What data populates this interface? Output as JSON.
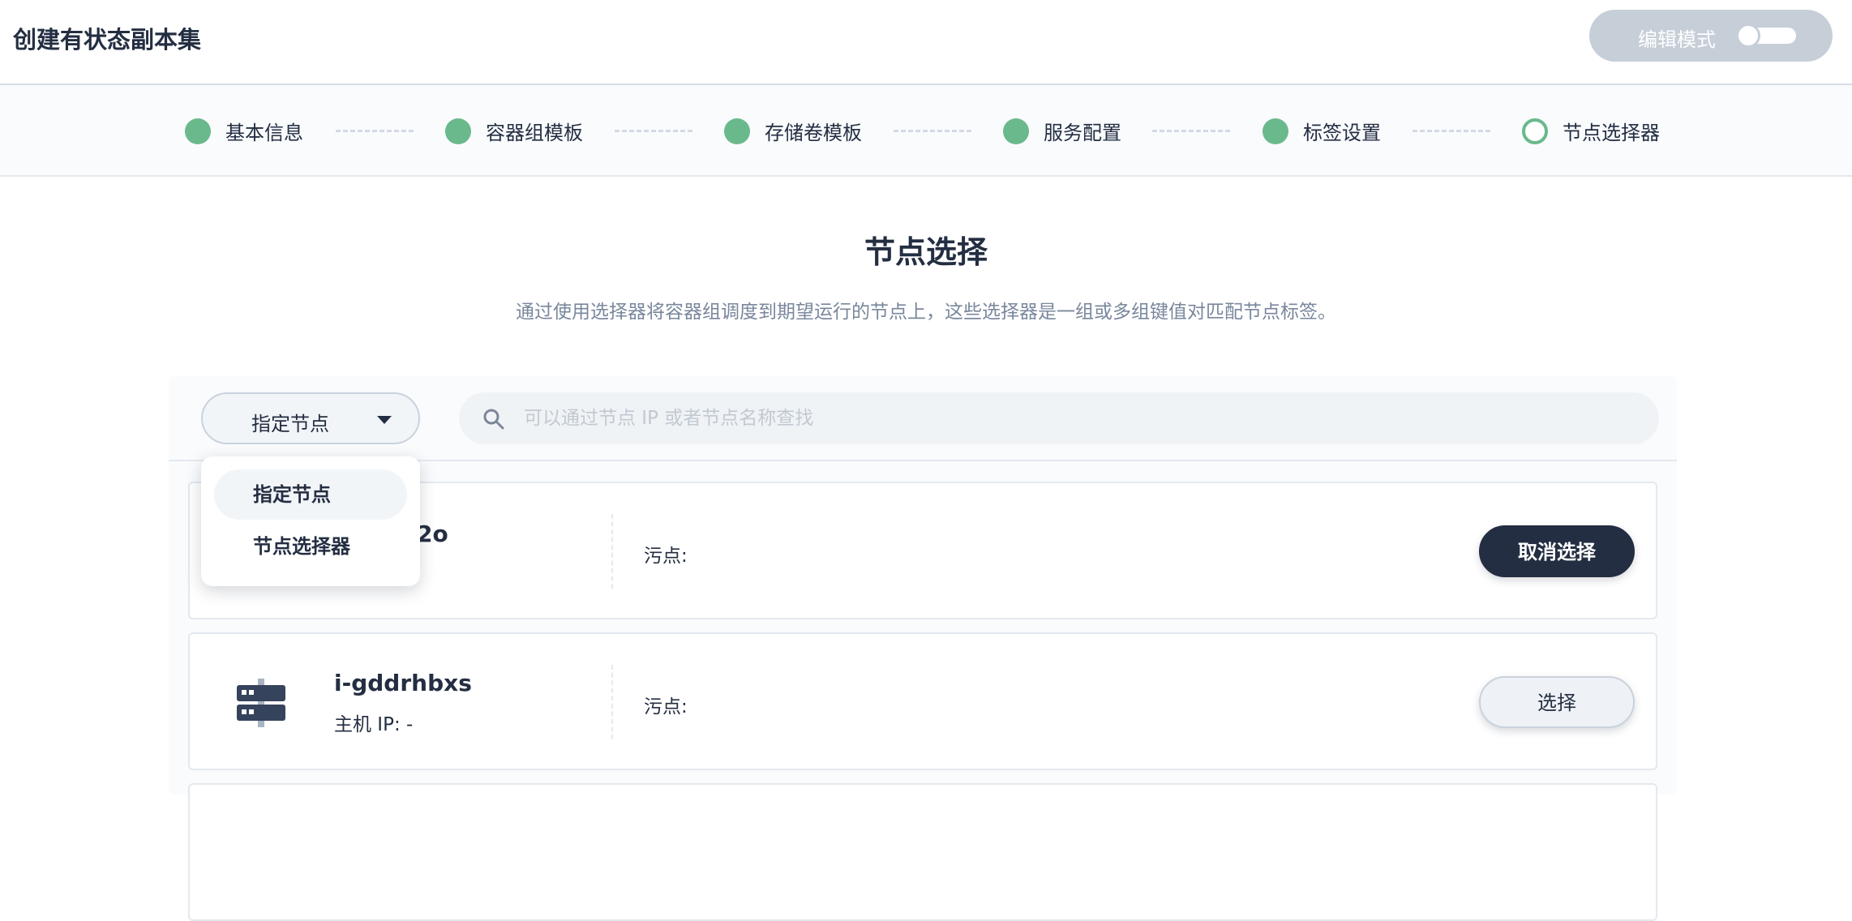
{
  "header": {
    "title": "创建有状态副本集",
    "edit_mode_label": "编辑模式"
  },
  "steps": [
    {
      "label": "基本信息",
      "status": "done"
    },
    {
      "label": "容器组模板",
      "status": "done"
    },
    {
      "label": "存储卷模板",
      "status": "done"
    },
    {
      "label": "服务配置",
      "status": "done"
    },
    {
      "label": "标签设置",
      "status": "done"
    },
    {
      "label": "节点选择器",
      "status": "current"
    }
  ],
  "section": {
    "title": "节点选择",
    "description": "通过使用选择器将容器组调度到期望运行的节点上，这些选择器是一组或多组键值对匹配节点标签。"
  },
  "toolbar": {
    "select_value": "指定节点",
    "search_placeholder": "可以通过节点 IP 或者节点名称查找"
  },
  "dropdown": {
    "options": [
      "指定节点",
      "节点选择器"
    ],
    "selected": "指定节点"
  },
  "nodes": [
    {
      "name_visible_fragment": "2o",
      "taint_label": "污点:",
      "button_label": "取消选择",
      "selected": true
    },
    {
      "name": "i-gddrhbxs",
      "ip": "主机 IP: -",
      "taint_label": "污点:",
      "button_label": "选择",
      "selected": false
    }
  ],
  "colors": {
    "step_done": "#6ab98c",
    "primary_dark": "#242e42",
    "muted_text": "#79879c"
  }
}
